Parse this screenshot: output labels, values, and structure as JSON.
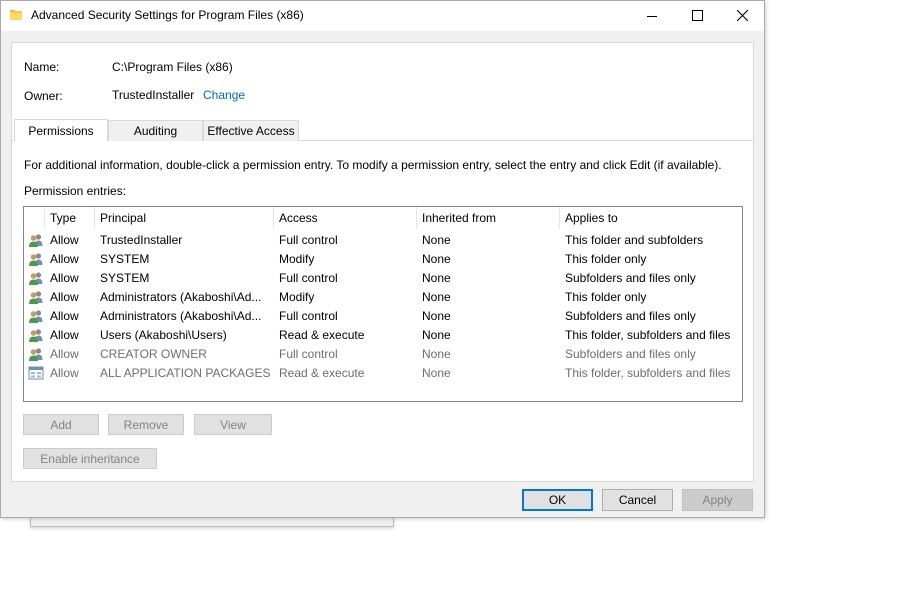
{
  "window": {
    "title": "Advanced Security Settings for Program Files (x86)"
  },
  "info": {
    "name_label": "Name:",
    "name_value": "C:\\Program Files (x86)",
    "owner_label": "Owner:",
    "owner_value": "TrustedInstaller",
    "change_link": "Change"
  },
  "tabs": [
    {
      "label": "Permissions",
      "active": true
    },
    {
      "label": "Auditing",
      "active": false
    },
    {
      "label": "Effective Access",
      "active": false
    }
  ],
  "instructions": "For additional information, double-click a permission entry. To modify a permission entry, select the entry and click Edit (if available).",
  "entries_label": "Permission entries:",
  "table": {
    "columns": [
      "Type",
      "Principal",
      "Access",
      "Inherited from",
      "Applies to"
    ],
    "rows": [
      {
        "type": "Allow",
        "principal": "TrustedInstaller",
        "access": "Full control",
        "inherited": "None",
        "applies": "This folder and subfolders",
        "icon": "users-icon",
        "dim": false
      },
      {
        "type": "Allow",
        "principal": "SYSTEM",
        "access": "Modify",
        "inherited": "None",
        "applies": "This folder only",
        "icon": "users-icon",
        "dim": false
      },
      {
        "type": "Allow",
        "principal": "SYSTEM",
        "access": "Full control",
        "inherited": "None",
        "applies": "Subfolders and files only",
        "icon": "users-icon",
        "dim": false
      },
      {
        "type": "Allow",
        "principal": "Administrators (Akaboshi\\Ad...",
        "access": "Modify",
        "inherited": "None",
        "applies": "This folder only",
        "icon": "users-icon",
        "dim": false
      },
      {
        "type": "Allow",
        "principal": "Administrators (Akaboshi\\Ad...",
        "access": "Full control",
        "inherited": "None",
        "applies": "Subfolders and files only",
        "icon": "users-icon",
        "dim": false
      },
      {
        "type": "Allow",
        "principal": "Users (Akaboshi\\Users)",
        "access": "Read & execute",
        "inherited": "None",
        "applies": "This folder, subfolders and files",
        "icon": "users-icon",
        "dim": false
      },
      {
        "type": "Allow",
        "principal": "CREATOR OWNER",
        "access": "Full control",
        "inherited": "None",
        "applies": "Subfolders and files only",
        "icon": "users-icon",
        "dim": true
      },
      {
        "type": "Allow",
        "principal": "ALL APPLICATION PACKAGES",
        "access": "Read & execute",
        "inherited": "None",
        "applies": "This folder, subfolders and files",
        "icon": "app-packages-icon",
        "dim": true
      }
    ]
  },
  "entry_buttons": {
    "add": "Add",
    "remove": "Remove",
    "view": "View"
  },
  "enable_inheritance": "Enable inheritance",
  "dialog_buttons": {
    "ok": "OK",
    "cancel": "Cancel",
    "apply": "Apply"
  },
  "colors": {
    "link": "#0066cc",
    "accent": "#0078d7"
  }
}
